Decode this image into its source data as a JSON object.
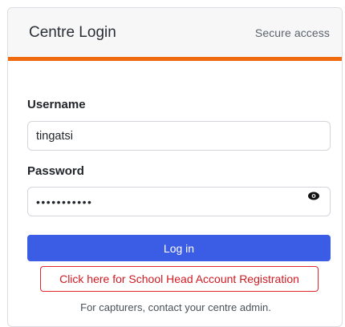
{
  "header": {
    "title": "Centre Login",
    "subtitle": "Secure access"
  },
  "colors": {
    "accent": "#f06a0f",
    "primary_button": "#3b5ce5",
    "danger": "#d11a22"
  },
  "form": {
    "username_label": "Username",
    "username_value": "tingatsi",
    "password_label": "Password",
    "password_mask": "•••••••••••",
    "password_toggle_icon": "eye-icon",
    "login_label": "Log in",
    "register_label": "Click here for School Head Account Registration",
    "help_text": "For capturers, contact your centre admin."
  }
}
